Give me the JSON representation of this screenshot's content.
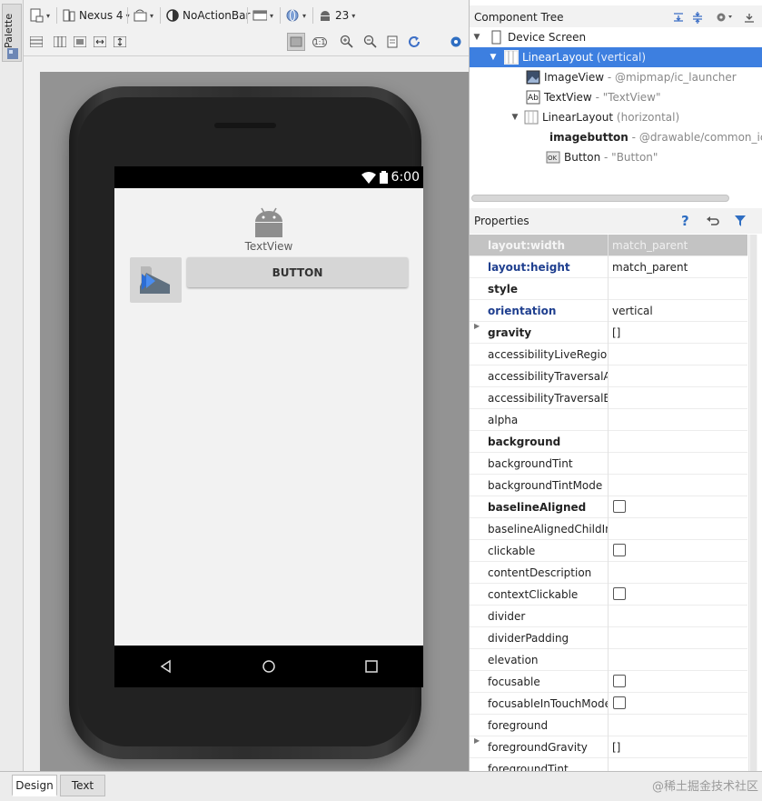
{
  "palette": {
    "label": "Palette"
  },
  "toolbar": {
    "device": "Nexus 4",
    "theme": "NoActionBar",
    "api": "23",
    "zoom_fit_label": "1:1"
  },
  "phone": {
    "time": "6:00",
    "textview": "TextView",
    "button": "BUTTON"
  },
  "component_tree": {
    "title": "Component Tree",
    "rows": [
      {
        "name": "Device Screen",
        "sub": ""
      },
      {
        "name": "LinearLayout",
        "sub": "(vertical)"
      },
      {
        "name": "ImageView",
        "sub": "- @mipmap/ic_launcher"
      },
      {
        "name": "TextView",
        "sub": "- \"TextView\""
      },
      {
        "name": "LinearLayout",
        "sub": "(horizontal)"
      },
      {
        "name": "imagebutton",
        "sub": "- @drawable/common_ic_"
      },
      {
        "name": "Button",
        "sub": "- \"Button\""
      }
    ]
  },
  "properties": {
    "title": "Properties",
    "rows": [
      {
        "name": "layout:width",
        "value": "match_parent"
      },
      {
        "name": "layout:height",
        "value": "match_parent"
      },
      {
        "name": "style",
        "value": ""
      },
      {
        "name": "orientation",
        "value": "vertical"
      },
      {
        "name": "gravity",
        "value": "[]"
      },
      {
        "name": "accessibilityLiveRegion",
        "value": ""
      },
      {
        "name": "accessibilityTraversalAfter",
        "value": ""
      },
      {
        "name": "accessibilityTraversalBefore",
        "value": ""
      },
      {
        "name": "alpha",
        "value": ""
      },
      {
        "name": "background",
        "value": ""
      },
      {
        "name": "backgroundTint",
        "value": ""
      },
      {
        "name": "backgroundTintMode",
        "value": ""
      },
      {
        "name": "baselineAligned",
        "value": ""
      },
      {
        "name": "baselineAlignedChildIndex",
        "value": ""
      },
      {
        "name": "clickable",
        "value": ""
      },
      {
        "name": "contentDescription",
        "value": ""
      },
      {
        "name": "contextClickable",
        "value": ""
      },
      {
        "name": "divider",
        "value": ""
      },
      {
        "name": "dividerPadding",
        "value": ""
      },
      {
        "name": "elevation",
        "value": ""
      },
      {
        "name": "focusable",
        "value": ""
      },
      {
        "name": "focusableInTouchMode",
        "value": ""
      },
      {
        "name": "foreground",
        "value": ""
      },
      {
        "name": "foregroundGravity",
        "value": "[]"
      },
      {
        "name": "foregroundTint",
        "value": ""
      }
    ]
  },
  "bottom_tabs": {
    "design": "Design",
    "text": "Text"
  },
  "watermark": "@稀土掘金技术社区"
}
